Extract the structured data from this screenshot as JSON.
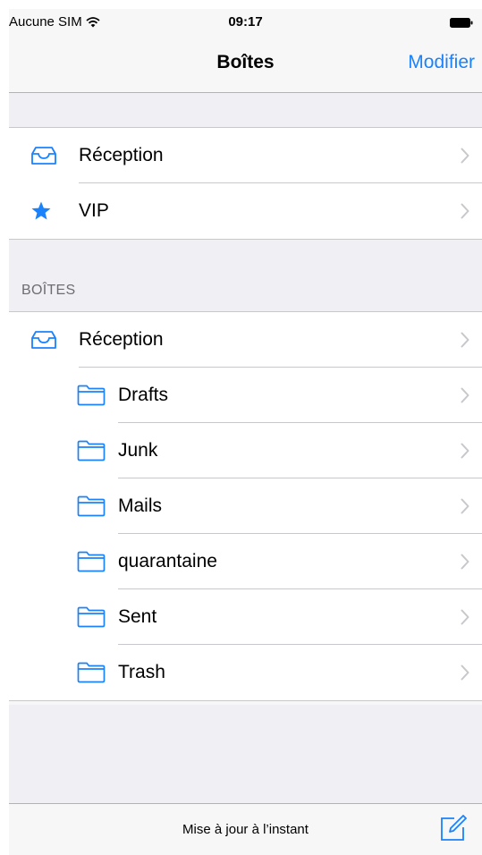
{
  "status_bar": {
    "carrier": "Aucune SIM",
    "time": "09:17"
  },
  "nav": {
    "title": "Boîtes",
    "edit_label": "Modifier"
  },
  "favorites": [
    {
      "label": "Réception",
      "icon": "inbox-icon"
    },
    {
      "label": "VIP",
      "icon": "star-icon"
    }
  ],
  "mailboxes_header": "BOÎTES",
  "mailboxes": [
    {
      "label": "Réception",
      "icon": "inbox-icon",
      "indent": false
    },
    {
      "label": "Drafts",
      "icon": "folder-icon",
      "indent": true
    },
    {
      "label": "Junk",
      "icon": "folder-icon",
      "indent": true
    },
    {
      "label": "Mails",
      "icon": "folder-icon",
      "indent": true
    },
    {
      "label": "quarantaine",
      "icon": "folder-icon",
      "indent": true
    },
    {
      "label": "Sent",
      "icon": "folder-icon",
      "indent": true
    },
    {
      "label": "Trash",
      "icon": "folder-icon",
      "indent": true
    }
  ],
  "toolbar": {
    "status": "Mise à jour à l’instant"
  },
  "colors": {
    "accent": "#1a82fb",
    "separator": "#c8c7cc",
    "group_bg": "#efeff4"
  }
}
